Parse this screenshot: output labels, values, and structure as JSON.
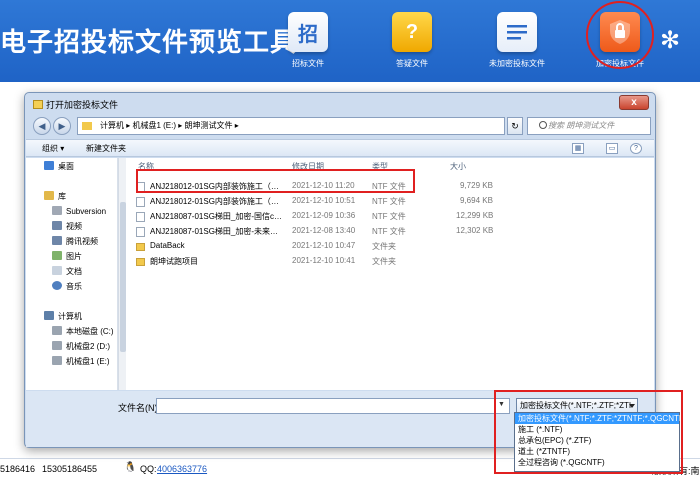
{
  "app": {
    "title": "电子招投标文件预览工具",
    "buttons": [
      {
        "label": "招标文件",
        "glyph": "招",
        "icon": "bid-file-icon"
      },
      {
        "label": "答疑文件",
        "glyph": "?",
        "icon": "question-file-icon"
      },
      {
        "label": "未加密投标文件",
        "glyph": "≡",
        "icon": "document-lines-icon"
      },
      {
        "label": "加密投标文件",
        "glyph": "🔒",
        "icon": "shield-lock-icon"
      }
    ],
    "footer": {
      "phone1": "5186416",
      "phone2": "15305186455",
      "qq_label": "QQ:",
      "qq_number": "4006363776",
      "right_text": "版权所有:南京"
    },
    "accent_color": "#2168cc",
    "highlight_color": "#e02020"
  },
  "dialog": {
    "title": "打开加密投标文件",
    "close_glyph": "x",
    "breadcrumb": "计算机 ▸ 机械盘1 (E:) ▸ 朗坤测试文件 ▸",
    "search_placeholder": "搜索 朗坤测试文件",
    "toolbar": {
      "organize": "组织 ▾",
      "new_folder": "新建文件夹"
    },
    "sidebar": [
      {
        "label": "桌面",
        "icon": "desktop-icon"
      },
      {
        "label": "库",
        "icon": "library-icon"
      },
      {
        "label": "Subversion",
        "icon": "svn-icon"
      },
      {
        "label": "视频",
        "icon": "video-icon"
      },
      {
        "label": "腾讯视频",
        "icon": "video-icon"
      },
      {
        "label": "图片",
        "icon": "picture-icon"
      },
      {
        "label": "文档",
        "icon": "document-icon"
      },
      {
        "label": "音乐",
        "icon": "music-icon"
      },
      {
        "label": "计算机",
        "icon": "computer-icon"
      },
      {
        "label": "本地磁盘 (C:)",
        "icon": "drive-icon"
      },
      {
        "label": "机械盘2 (D:)",
        "icon": "drive-icon"
      },
      {
        "label": "机械盘1 (E:)",
        "icon": "drive-icon"
      }
    ],
    "columns": [
      "名称",
      "修改日期",
      "类型",
      "大小"
    ],
    "files": [
      {
        "name": "ANJ218012-01SG内部装饰施工（…",
        "date": "2021-12-10 11:20",
        "type": "NTF 文件",
        "size": "9,729 KB",
        "kind": "file"
      },
      {
        "name": "ANJ218012-01SG内部装饰施工（…",
        "date": "2021-12-10 10:51",
        "type": "NTF 文件",
        "size": "9,694 KB",
        "kind": "file"
      },
      {
        "name": "ANJ218087-01SG梯田_加密-国信c…",
        "date": "2021-12-09 10:36",
        "type": "NTF 文件",
        "size": "12,299 KB",
        "kind": "file"
      },
      {
        "name": "ANJ218087-01SG梯田_加密-未来…",
        "date": "2021-12-08 13:40",
        "type": "NTF 文件",
        "size": "12,302 KB",
        "kind": "file"
      },
      {
        "name": "DataBack",
        "date": "2021-12-10 10:47",
        "type": "文件夹",
        "size": "",
        "kind": "folder"
      },
      {
        "name": "朗坤试跑项目",
        "date": "2021-12-10 10:41",
        "type": "文件夹",
        "size": "",
        "kind": "folder"
      }
    ],
    "filename_label": "文件名(N):",
    "filename_value": "",
    "filter_selected": "加密投标文件(*.NTF;*.ZTF;*ZTI",
    "filter_options": [
      "加密投标文件(*.NTF;*.ZTF;*ZTNTF;*.QGCNTF)",
      "施工 (*.NTF)",
      "总承包(EPC) (*.ZTF)",
      "道土 (*ZTNTF)",
      "全过程咨询 (*.QGCNTF)"
    ]
  }
}
